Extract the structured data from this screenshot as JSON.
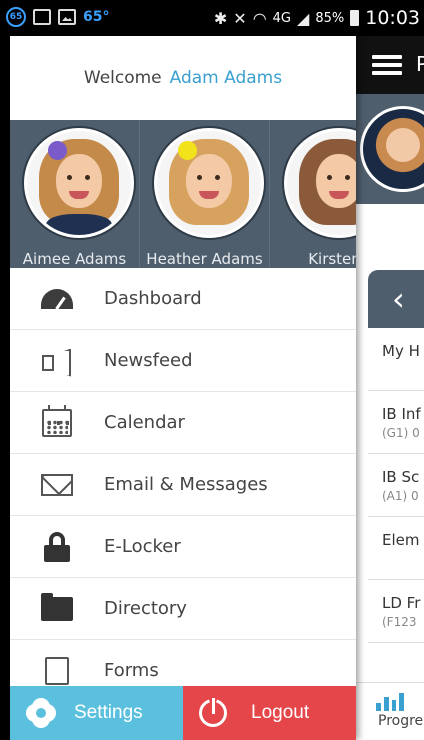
{
  "status_bar": {
    "badge": "65",
    "temperature": "65°",
    "network": "4G",
    "battery": "85%",
    "time": "10:03"
  },
  "drawer": {
    "welcome_label": "Welcome",
    "user_name": "Adam Adams",
    "children": [
      {
        "name": "Aimee Adams"
      },
      {
        "name": "Heather Adams"
      },
      {
        "name": "Kirsten"
      }
    ],
    "menu": [
      {
        "label": "Dashboard",
        "icon": "dashboard-gauge-icon"
      },
      {
        "label": "Newsfeed",
        "icon": "speaker-icon"
      },
      {
        "label": "Calendar",
        "icon": "calendar-icon"
      },
      {
        "label": "Email & Messages",
        "icon": "envelope-icon"
      },
      {
        "label": "E-Locker",
        "icon": "lock-icon"
      },
      {
        "label": "Directory",
        "icon": "folder-icon"
      },
      {
        "label": "Forms",
        "icon": "form-document-icon"
      }
    ],
    "settings_label": "Settings",
    "logout_label": "Logout"
  },
  "background_app": {
    "title_fragment": "P",
    "list_items": [
      {
        "title": "My H",
        "sub": ""
      },
      {
        "title": "IB Inf",
        "sub": "(G1) 0"
      },
      {
        "title": "IB Sc",
        "sub": "(A1) 0"
      },
      {
        "title": "Elem",
        "sub": ""
      },
      {
        "title": "LD Fr",
        "sub": "(F123"
      }
    ],
    "tab_label": "Progre"
  },
  "colors": {
    "accent_blue": "#3aa0d0",
    "band_slate": "#4f5e6d",
    "settings_bg": "#5bc0de",
    "logout_bg": "#e5464a"
  }
}
